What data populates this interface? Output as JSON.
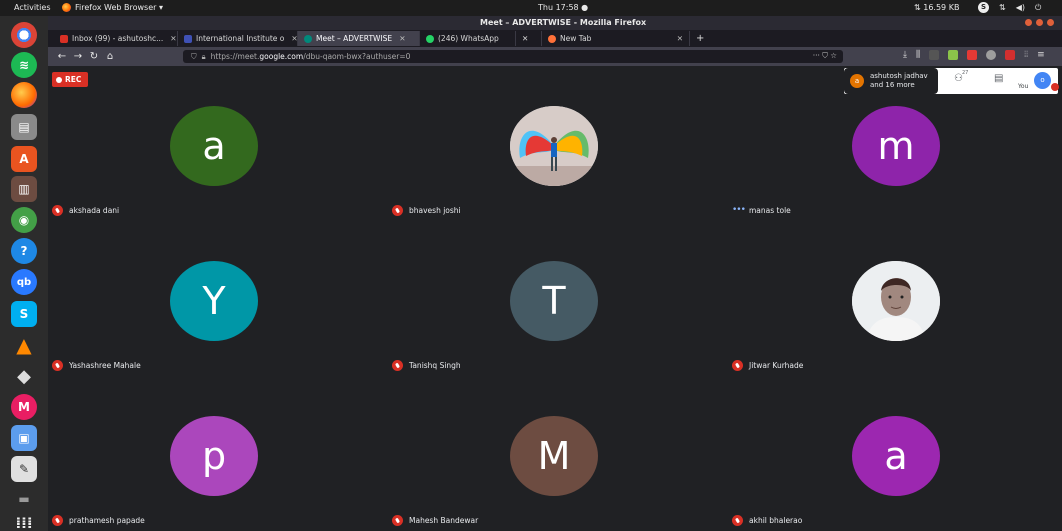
{
  "system": {
    "activities": "Activities",
    "app_menu": "Firefox Web Browser ▾",
    "clock": "Thu 17:58 ●",
    "net_speed": "⇅ 16.59 KB"
  },
  "window": {
    "title": "Meet – ADVERTWISE - Mozilla Firefox"
  },
  "tabs": [
    {
      "label": "Inbox (99) - ashutoshc..."
    },
    {
      "label": "International Institute o"
    },
    {
      "label": "Meet – ADVERTWISE"
    },
    {
      "label": "(246) WhatsApp"
    },
    {
      "label": ""
    },
    {
      "label": "New Tab"
    }
  ],
  "url": {
    "prefix": "https://meet.",
    "host": "google.com",
    "path": "/dbu-qaom-bwx?authuser=0"
  },
  "meet": {
    "rec_label": "REC",
    "joined_initial": "a",
    "joined_line1": "ashutosh jadhav",
    "joined_line2": "and 16 more",
    "people_count": "27",
    "you_label": "You",
    "you_initial": "o"
  },
  "participants": [
    {
      "name": "akshada dani",
      "initial": "a",
      "color": "#33691e",
      "muted": true
    },
    {
      "name": "bhavesh joshi",
      "initial": "",
      "color": "#cfd8dc",
      "muted": true,
      "photo": "wings"
    },
    {
      "name": "manas tole",
      "initial": "m",
      "color": "#8e24aa",
      "muted": false
    },
    {
      "name": "Yashashree Mahale",
      "initial": "Y",
      "color": "#0097a7",
      "muted": true
    },
    {
      "name": "Tanishq Singh",
      "initial": "T",
      "color": "#455a64",
      "muted": true
    },
    {
      "name": "Jitwar Kurhade",
      "initial": "",
      "color": "#e0e0e0",
      "muted": true,
      "photo": "face"
    },
    {
      "name": "prathamesh papade",
      "initial": "p",
      "color": "#ab47bc",
      "muted": true
    },
    {
      "name": "Mahesh Bandewar",
      "initial": "M",
      "color": "#6d4c41",
      "muted": true
    },
    {
      "name": "akhil bhalerao",
      "initial": "a",
      "color": "#9c27b0",
      "muted": true
    }
  ]
}
